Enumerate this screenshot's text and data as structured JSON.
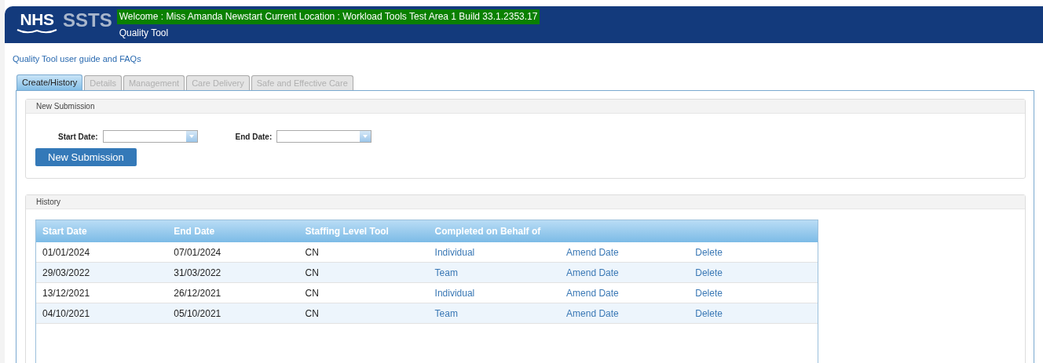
{
  "header": {
    "logo_text": "NHS",
    "product": "SSTS",
    "welcome": "Welcome : Miss Amanda Newstart Current Location : Workload Tools Test Area 1 Build 33.1.2353.17",
    "subtitle": "Quality Tool"
  },
  "help_link": "Quality Tool user guide and FAQs",
  "tabs": [
    {
      "label": "Create/History",
      "selected": true,
      "disabled": false
    },
    {
      "label": "Details",
      "selected": false,
      "disabled": true
    },
    {
      "label": "Management",
      "selected": false,
      "disabled": true
    },
    {
      "label": "Care Delivery",
      "selected": false,
      "disabled": true
    },
    {
      "label": "Safe and Effective Care",
      "selected": false,
      "disabled": true
    }
  ],
  "new_submission": {
    "title": "New Submission",
    "fields": [
      {
        "label": "Start Date:"
      },
      {
        "label": "End Date:"
      }
    ],
    "button": "New Submission"
  },
  "history": {
    "title": "History",
    "columns": [
      "Start Date",
      "End Date",
      "Staffing Level Tool",
      "Completed on Behalf of"
    ],
    "rows": [
      {
        "cells": [
          "01/01/2024",
          "07/01/2024",
          "CN",
          "Individual"
        ],
        "actions": [
          "Amend Date",
          "Delete"
        ]
      },
      {
        "cells": [
          "29/03/2022",
          "31/03/2022",
          "CN",
          "Team"
        ],
        "actions": [
          "Amend Date",
          "Delete"
        ]
      },
      {
        "cells": [
          "13/12/2021",
          "26/12/2021",
          "CN",
          "Individual"
        ],
        "actions": [
          "Amend Date",
          "Delete"
        ]
      },
      {
        "cells": [
          "04/10/2021",
          "05/10/2021",
          "CN",
          "Team"
        ],
        "actions": [
          "Amend Date",
          "Delete"
        ]
      }
    ]
  }
}
